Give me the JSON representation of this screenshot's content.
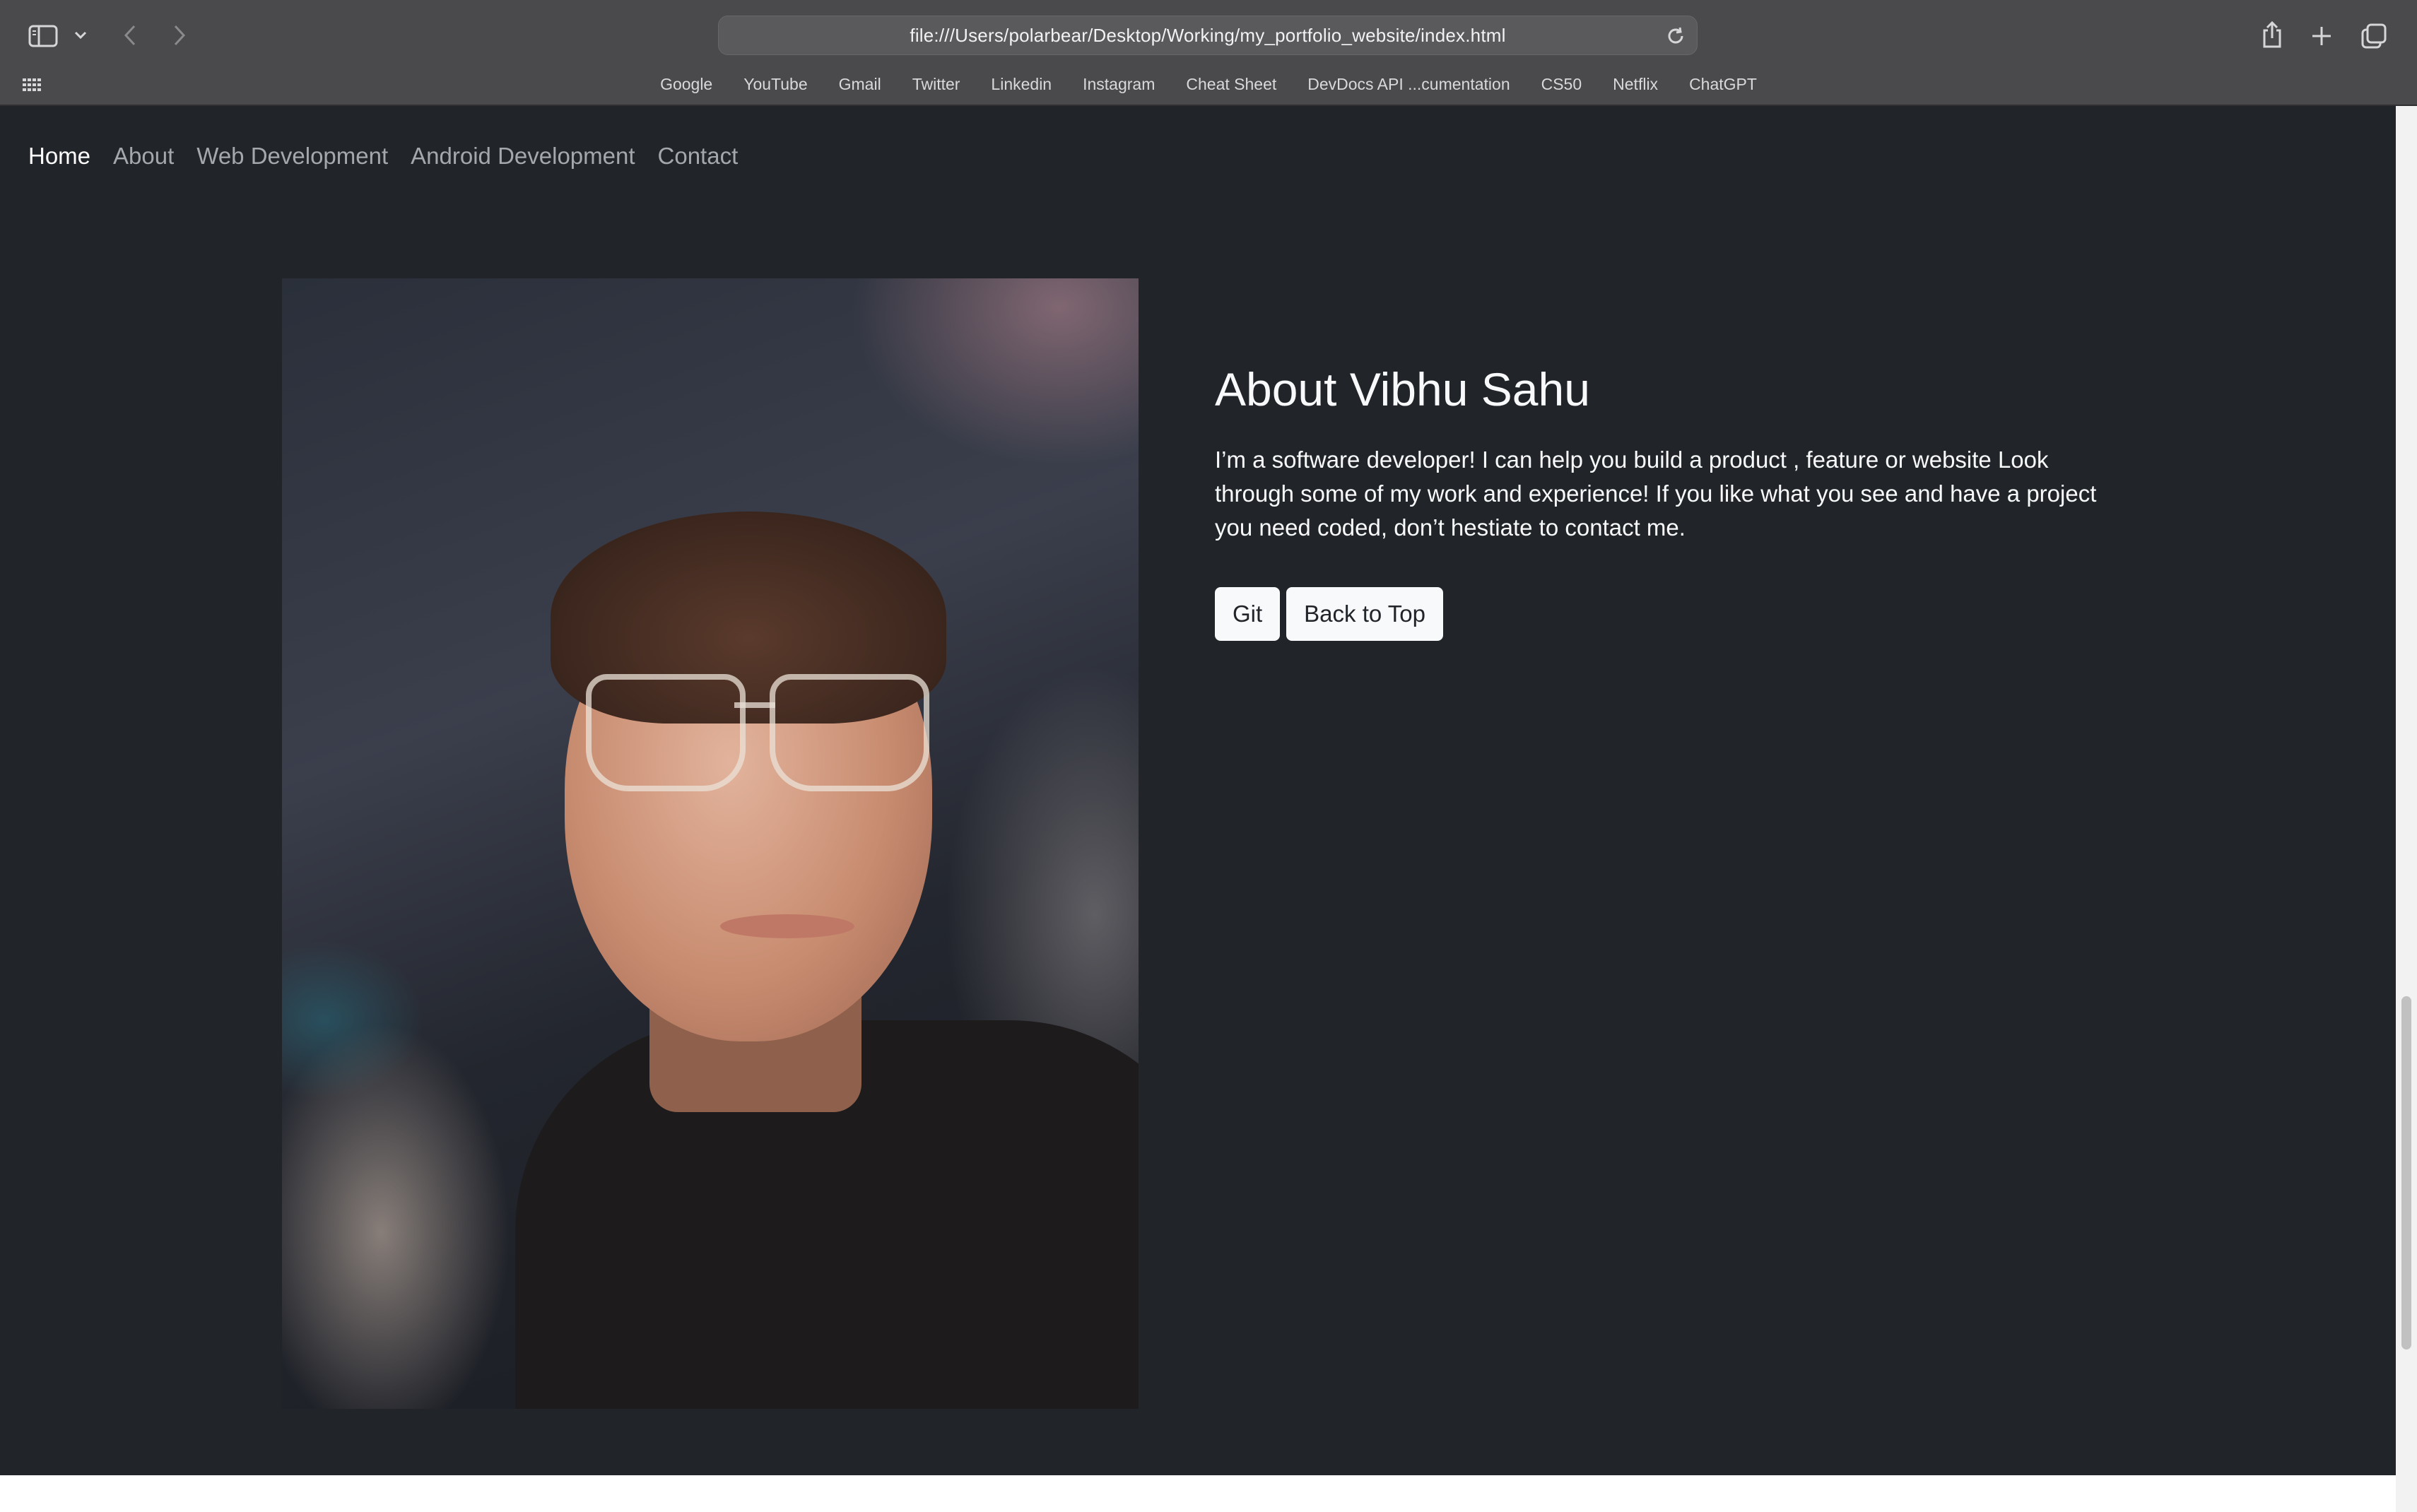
{
  "browser": {
    "url": "file:///Users/polarbear/Desktop/Working/my_portfolio_website/index.html",
    "bookmarks": [
      "Google",
      "YouTube",
      "Gmail",
      "Twitter",
      "Linkedin",
      "Instagram",
      "Cheat Sheet",
      "DevDocs API ...cumentation",
      "CS50",
      "Netflix",
      "ChatGPT"
    ]
  },
  "nav": {
    "items": [
      "Home",
      "About",
      "Web Development",
      "Android Development",
      "Contact"
    ],
    "active": "Home"
  },
  "about": {
    "title": "About Vibhu Sahu",
    "body": "I’m a software developer! I can help you build a product , feature or website Look through some of my work and experience! If you like what you see and have a project you need coded, don’t hestiate to contact me.",
    "buttons": {
      "git": "Git",
      "back_to_top": "Back to Top"
    }
  }
}
